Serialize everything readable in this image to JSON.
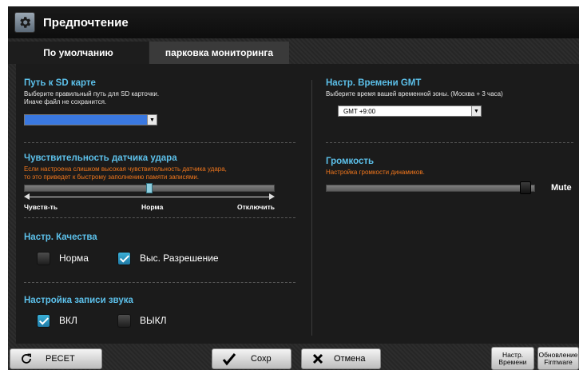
{
  "window": {
    "title": "Предпочтение"
  },
  "tabs": [
    {
      "label": "По умолчанию",
      "active": true
    },
    {
      "label": "парковка мониторинга",
      "active": false
    }
  ],
  "sd_card": {
    "title": "Путь к SD карте",
    "desc_line1": "Выберите правильный путь для SD карточки.",
    "desc_line2": "Иначе файл не сохранится.",
    "value": ""
  },
  "gmt": {
    "title": "Настр. Времени GMT",
    "desc": "Выберите время вашей временной зоны. (Москва + 3 часа)",
    "value": "GMT +9:00"
  },
  "shock": {
    "title": "Чувствительность датчика удара",
    "desc_line1": "Если настроена слишком высокая чувствительность датчика удара,",
    "desc_line2": "то это приведет к быстрому заполнению памяти записями.",
    "label_left": "Чувств-ть",
    "label_mid": "Норма",
    "label_right": "Отключить",
    "level": 0.5
  },
  "volume": {
    "title": "Громкость",
    "desc": "Настройка громкости динамиков.",
    "mute_label": "Mute",
    "level": 0.97
  },
  "quality": {
    "title": "Настр. Качества",
    "options": [
      {
        "label": "Норма",
        "checked": false
      },
      {
        "label": "Выс. Разрешение",
        "checked": true
      }
    ]
  },
  "sound_rec": {
    "title": "Настройка записи звука",
    "options": [
      {
        "label": "ВКЛ",
        "checked": true
      },
      {
        "label": "ВЫКЛ",
        "checked": false
      }
    ]
  },
  "buttons": {
    "reset": "РЕСЕТ",
    "save": "Сохр",
    "cancel": "Отмена",
    "time_line1": "Настр.",
    "time_line2": "Времени",
    "fw_line1": "Обновление",
    "fw_line2": "Firmware"
  },
  "colors": {
    "accent": "#5cc0ea",
    "warning": "#f0761c",
    "checked": "#2b96c4"
  },
  "icons": {
    "title": "gear-icon",
    "reset": "refresh-icon",
    "save": "checkmark-icon",
    "cancel": "x-icon"
  }
}
